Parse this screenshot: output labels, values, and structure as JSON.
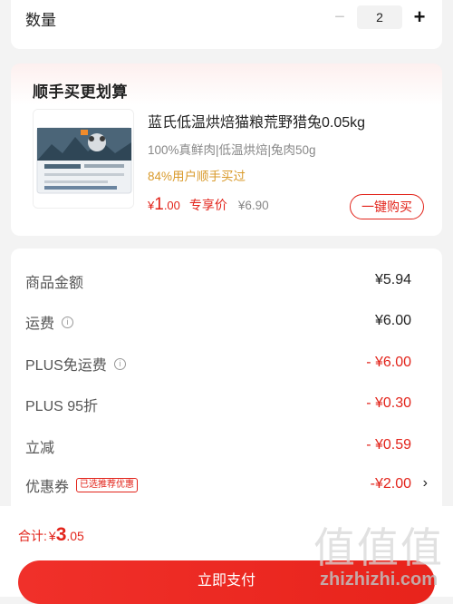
{
  "quantity": {
    "label": "数量",
    "minus": "−",
    "value": "2",
    "plus": "+"
  },
  "upsell": {
    "title": "顺手买更划算",
    "product": {
      "name": "蓝氏低温烘焙猫粮荒野猎兔0.05kg",
      "desc": "100%真鲜肉|低温烘焙|兔肉50g",
      "stat": "84%用户顺手买过",
      "price_currency": "¥",
      "price_int": "1",
      "price_dec": ".00",
      "price_tag": "专享价",
      "orig_price": "¥6.90",
      "buy_label": "一键购买"
    }
  },
  "summary": {
    "rows": [
      {
        "label": "商品金额",
        "amount": "¥5.94"
      },
      {
        "label": "运费",
        "amount": "¥6.00"
      },
      {
        "label": "PLUS免运费",
        "amount": "- ¥6.00"
      },
      {
        "label": "PLUS 95折",
        "amount": "- ¥0.30"
      },
      {
        "label": "立减",
        "amount": "- ¥0.59"
      },
      {
        "label": "优惠券",
        "amount": "-¥2.00",
        "badge": "已选推荐优惠"
      }
    ]
  },
  "footer": {
    "total_label": "合计:",
    "total_currency": "¥",
    "total_int": "3",
    "total_dec": ".05",
    "pay_label": "立即支付"
  },
  "watermark": {
    "text": "zhizhizhi.com"
  },
  "colors": {
    "accent": "#e2231a",
    "stat": "#d99a2b"
  }
}
